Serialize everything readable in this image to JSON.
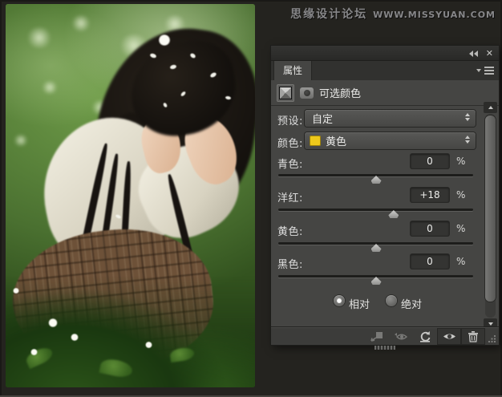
{
  "watermark": {
    "site_name": "思缘设计论坛",
    "site_url": "WWW.MISSYUAN.COM"
  },
  "panel": {
    "titlebar": {
      "close_glyph": "✕"
    },
    "tab_label": "属性",
    "header_title": "可选颜色",
    "preset_label": "预设:",
    "preset_value": "自定",
    "color_label": "颜色:",
    "color_value": "黄色",
    "color_swatch": "#eec young",
    "sliders": [
      {
        "label": "青色:",
        "display": "0",
        "value": 0,
        "unit": "%"
      },
      {
        "label": "洋红:",
        "display": "+18",
        "value": 18,
        "unit": "%"
      },
      {
        "label": "黄色:",
        "display": "0",
        "value": 0,
        "unit": "%"
      },
      {
        "label": "黑色:",
        "display": "0",
        "value": 0,
        "unit": "%"
      }
    ],
    "mode_options": [
      {
        "label": "相对",
        "selected": true
      },
      {
        "label": "绝对",
        "selected": false
      }
    ]
  },
  "colors": {
    "swatch_yellow": "#eec91b",
    "panel_bg": "#454543",
    "accent_text": "#eaeae8"
  }
}
